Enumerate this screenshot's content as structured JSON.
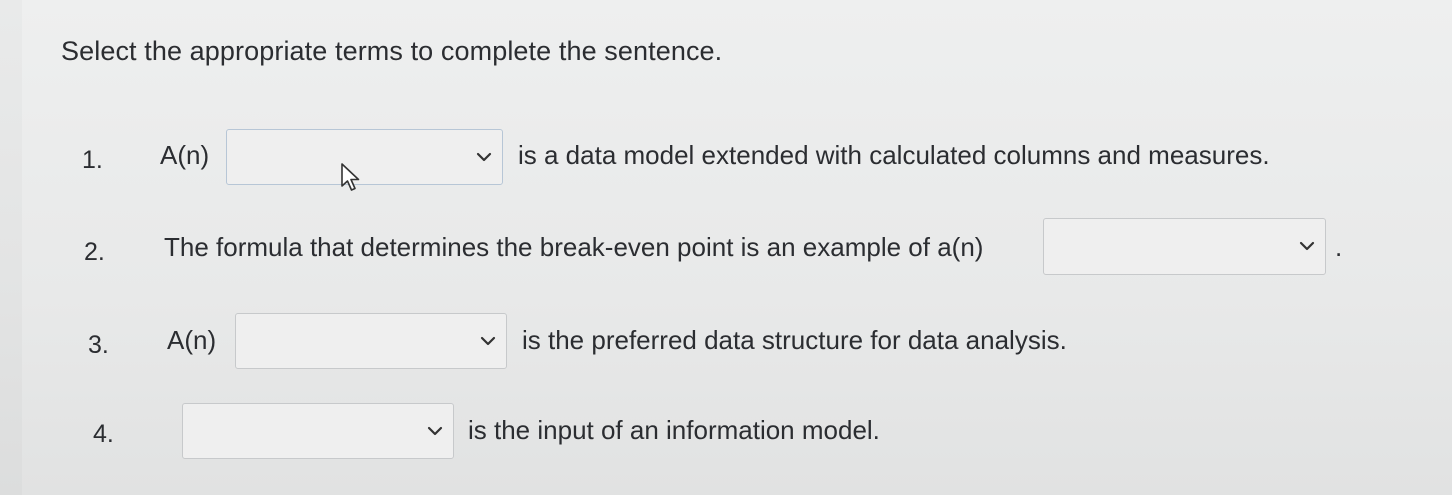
{
  "instruction": "Select the appropriate terms to complete the sentence.",
  "items": [
    {
      "number": "1.",
      "prefix": "A(n)",
      "dropdown_value": "",
      "suffix": "is a data model extended with calculated columns and measures."
    },
    {
      "number": "2.",
      "prefix": "The formula that determines the break-even point is an example of a(n)",
      "dropdown_value": "",
      "suffix": "."
    },
    {
      "number": "3.",
      "prefix": "A(n)",
      "dropdown_value": "",
      "suffix": "is the preferred data structure for data analysis."
    },
    {
      "number": "4.",
      "prefix": "",
      "dropdown_value": "",
      "suffix": "is the input of an information model."
    }
  ],
  "icons": {
    "dropdown": "chevron-down-icon",
    "cursor": "mouse-pointer-icon"
  }
}
